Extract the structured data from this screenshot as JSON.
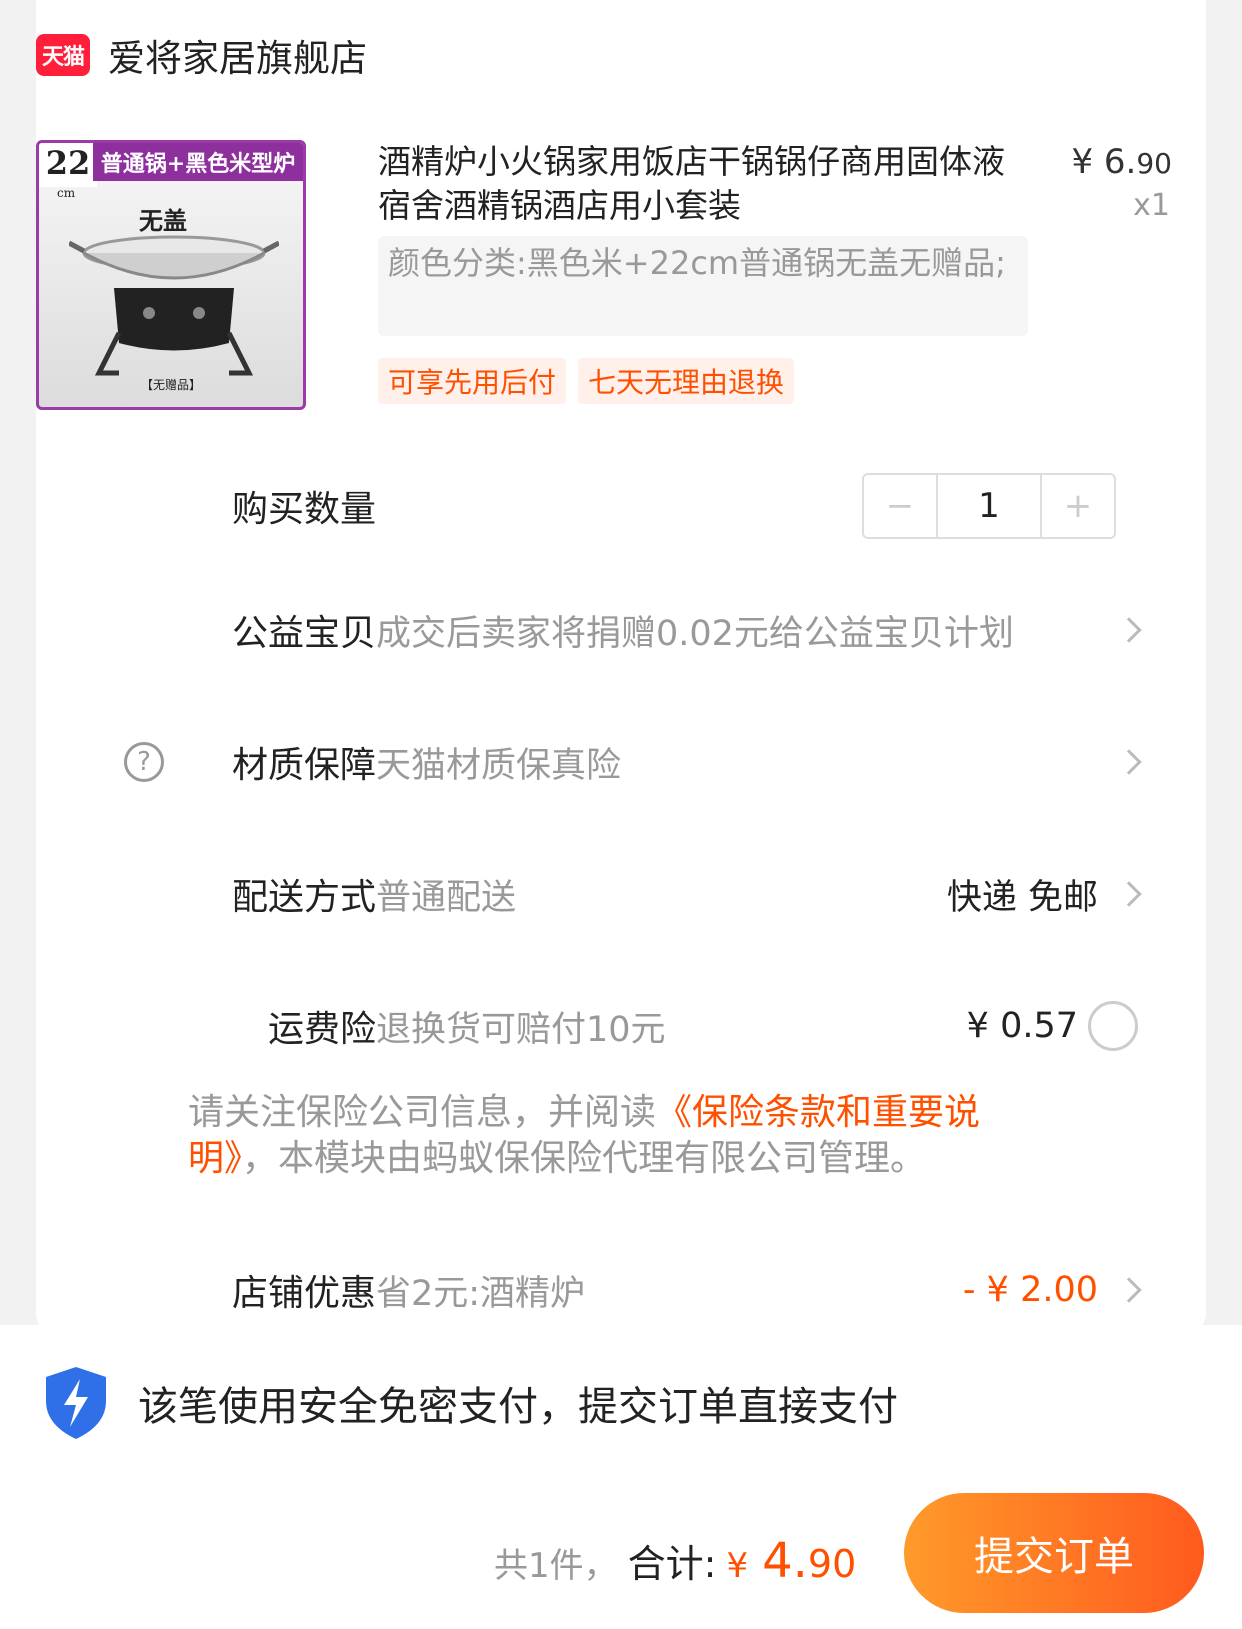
{
  "shop": {
    "logo_text": "天猫",
    "name": "爱将家居旗舰店"
  },
  "product": {
    "thumb": {
      "size": "22",
      "size_unit": "cm",
      "banner": "普通锅+黑色米型炉",
      "lid": "无盖",
      "gift": "【无赠品】"
    },
    "title": "酒精炉小火锅家用饭店干锅锅仔商用固体液宿舍酒精锅酒店用小套装",
    "price_main": "¥ 6.",
    "price_cents": "90",
    "quantity_label": "x1",
    "sku": "颜色分类:黑色米+22cm普通锅无盖无赠品;",
    "tags": [
      "可享先用后付",
      "七天无理由退换"
    ]
  },
  "quantity": {
    "label": "购买数量",
    "minus": "−",
    "value": "1",
    "plus": "+"
  },
  "charity": {
    "label": "公益宝贝",
    "value": "成交后卖家将捐赠0.02元给公益宝贝计划"
  },
  "material": {
    "label": "材质保障",
    "value": "天猫材质保真险",
    "help_icon": "?"
  },
  "delivery": {
    "label": "配送方式",
    "value": "普通配送",
    "right": "快递 免邮"
  },
  "shipping_insurance": {
    "label": "运费险",
    "value": "退换货可赔付10元",
    "price": "¥ 0.57"
  },
  "notice": {
    "prefix": "请关注保险公司信息，并阅读",
    "link": "《保险条款和重要说明》",
    "suffix": "，本模块由蚂蚁保保险代理有限公司管理。"
  },
  "store_discount": {
    "label": "店铺优惠",
    "value": "省2元:酒精炉",
    "amount": "- ¥ 2.00"
  },
  "secure_payment": {
    "text": "该笔使用安全免密支付，提交订单直接支付"
  },
  "footer": {
    "count": "共1件，",
    "sum_label": "合计:",
    "currency": "¥",
    "amount": "4.",
    "amount_cents": "90",
    "submit_label": "提交订单"
  },
  "colors": {
    "accent": "#ff5000",
    "tmall_red": "#ff1f3a",
    "shield_blue": "#2f6fe8"
  },
  "icons": [
    "tmall-logo",
    "help-circle-icon",
    "chevron-right-icon",
    "radio-icon",
    "shield-lightning-icon"
  ]
}
